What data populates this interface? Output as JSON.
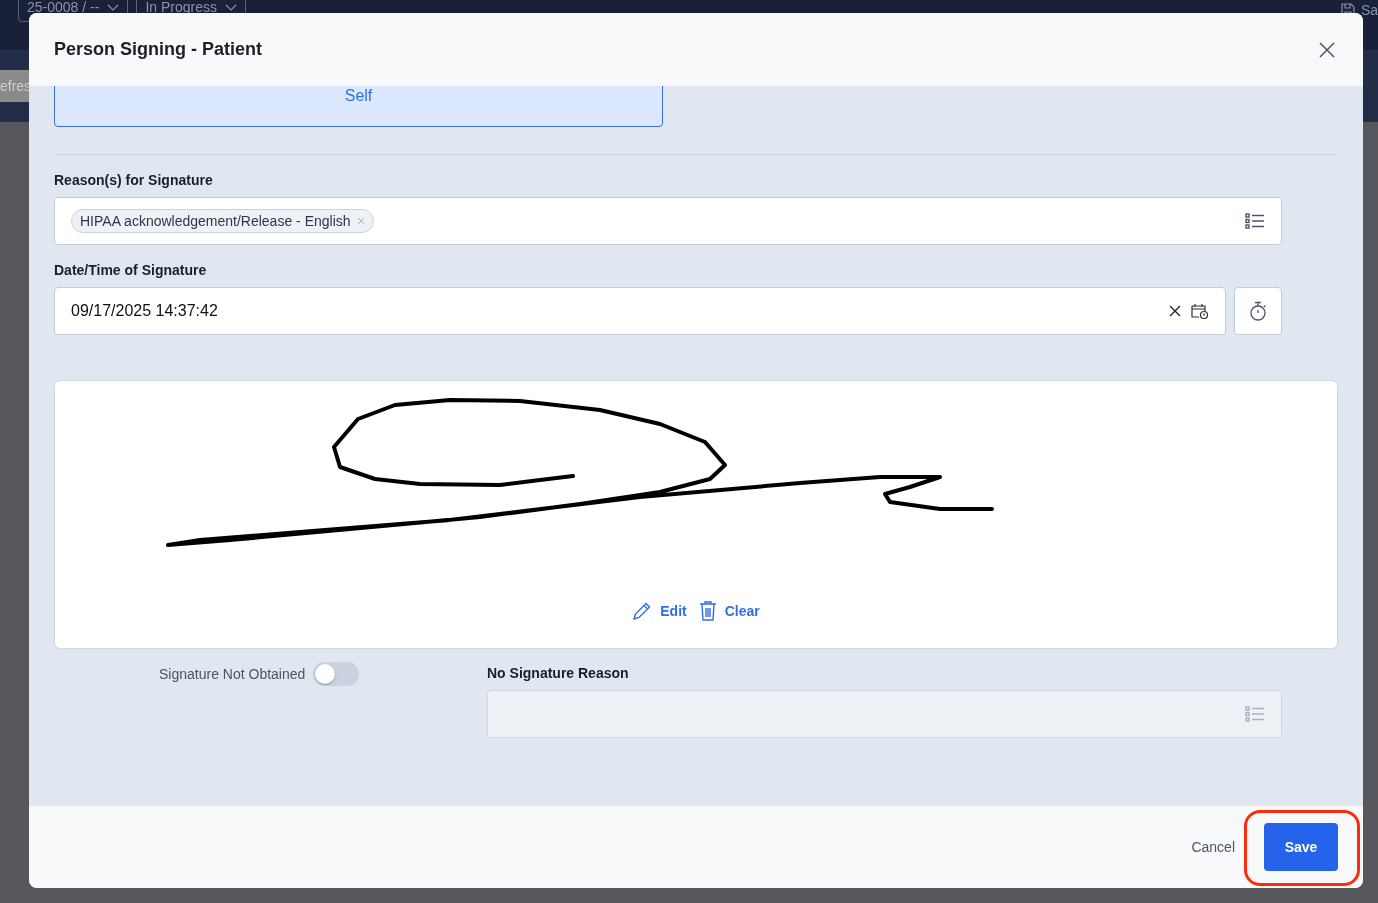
{
  "background": {
    "record_select": "25-0008 / --",
    "status_select": "In Progress",
    "left_text": "efres",
    "right_text": "Sa"
  },
  "dialog": {
    "title": "Person Signing - Patient",
    "person_option": {
      "label": "Self",
      "selected": true
    },
    "reasons": {
      "label": "Reason(s) for Signature",
      "tags": [
        "HIPAA acknowledgement/Release - English"
      ]
    },
    "datetime": {
      "label": "Date/Time of Signature",
      "value": "09/17/2025 14:37:42"
    },
    "signature_actions": [
      "Edit",
      "Clear"
    ],
    "not_obtained": {
      "label": "Signature Not Obtained",
      "on": false
    },
    "no_signature_reason": {
      "label": "No Signature Reason",
      "disabled": true
    },
    "buttons": [
      {
        "label": "Cancel",
        "kind": "secondary",
        "highlighted": false
      },
      {
        "label": "Save",
        "kind": "primary",
        "highlighted": true
      }
    ]
  }
}
